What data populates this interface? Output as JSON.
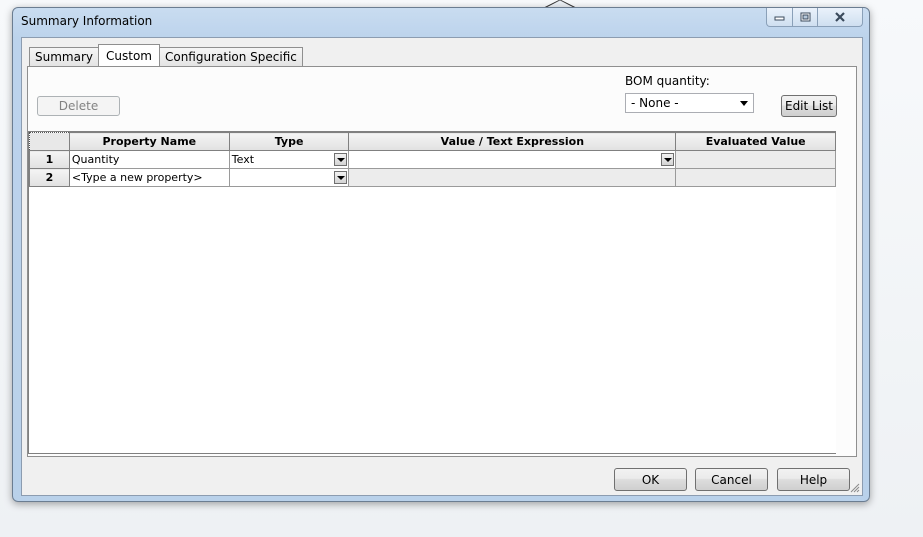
{
  "window": {
    "title": "Summary Information"
  },
  "tabs": [
    {
      "label": "Summary",
      "active": false
    },
    {
      "label": "Custom",
      "active": true
    },
    {
      "label": "Configuration Specific",
      "active": false
    }
  ],
  "toolbar": {
    "delete_label": "Delete",
    "edit_list_label": "Edit List"
  },
  "bom": {
    "label": "BOM quantity:",
    "selected": "- None -"
  },
  "grid": {
    "columns": [
      "Property Name",
      "Type",
      "Value / Text Expression",
      "Evaluated Value"
    ],
    "rows": [
      {
        "num": "1",
        "property": "Quantity",
        "type": "Text",
        "value": "",
        "evaluated": ""
      },
      {
        "num": "2",
        "property": "<Type a new property>",
        "type": "",
        "value": "",
        "evaluated": ""
      }
    ]
  },
  "footer": {
    "ok_label": "OK",
    "cancel_label": "Cancel",
    "help_label": "Help"
  },
  "icons": [
    "minimize-icon",
    "maximize-icon",
    "close-icon",
    "dropdown-arrow-icon",
    "resize-grip-icon"
  ]
}
